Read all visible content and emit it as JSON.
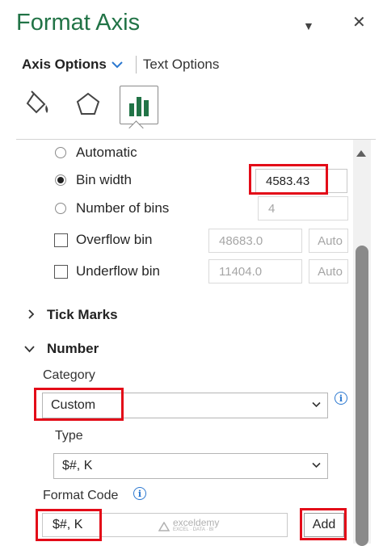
{
  "panel": {
    "title": "Format Axis",
    "menu_glyph": "▼",
    "close_glyph": "✕"
  },
  "tabs": {
    "axis_options": "Axis Options",
    "text_options": "Text Options"
  },
  "icons": {
    "fill_line": "paint-bucket-icon",
    "effects": "pentagon-icon",
    "axis_options": "bar-chart-icon",
    "active_color": "#217346"
  },
  "bins": {
    "automatic": "Automatic",
    "bin_width_label": "Bin width",
    "bin_width_value": "4583.43",
    "number_of_bins_label": "Number of bins",
    "number_of_bins_value": "4",
    "overflow_label": "Overflow bin",
    "overflow_value": "48683.0",
    "underflow_label": "Underflow bin",
    "underflow_value": "11404.0",
    "auto_label": "Auto",
    "selected": "bin_width"
  },
  "sections": {
    "tick_marks": "Tick Marks",
    "number": "Number"
  },
  "number": {
    "category_label": "Category",
    "category_value": "Custom",
    "type_label": "Type",
    "type_value": "$#, K",
    "format_code_label": "Format Code",
    "format_code_value": "$#, K",
    "add_label": "Add"
  },
  "watermark": {
    "brand": "exceldemy",
    "tagline": "EXCEL · DATA · BI"
  },
  "colors": {
    "title": "#217346",
    "highlight": "#e30b18",
    "info": "#2b78d0"
  }
}
